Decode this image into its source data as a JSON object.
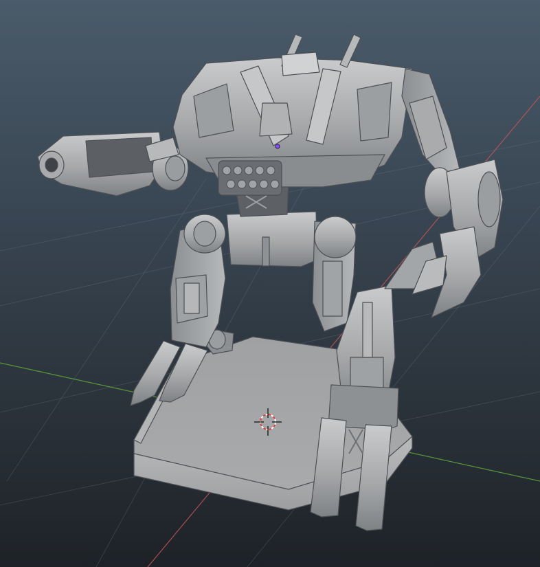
{
  "viewport": {
    "kind": "3d-viewport",
    "background_top": "#4a5b6a",
    "background_bottom": "#1e2227"
  },
  "scene": {
    "object": "mech-model",
    "material_color": "#a7a9ab",
    "shadow_color": "#6f7275",
    "dark_color": "#4f5256"
  },
  "axes": {
    "x_color": "#c05656",
    "y_color": "#5ea33a"
  },
  "cursor": {
    "icon": "3d-cursor-icon",
    "colors": [
      "#e04040",
      "#ffffff"
    ]
  },
  "selection": {
    "origin_color": "#8a4fff"
  }
}
